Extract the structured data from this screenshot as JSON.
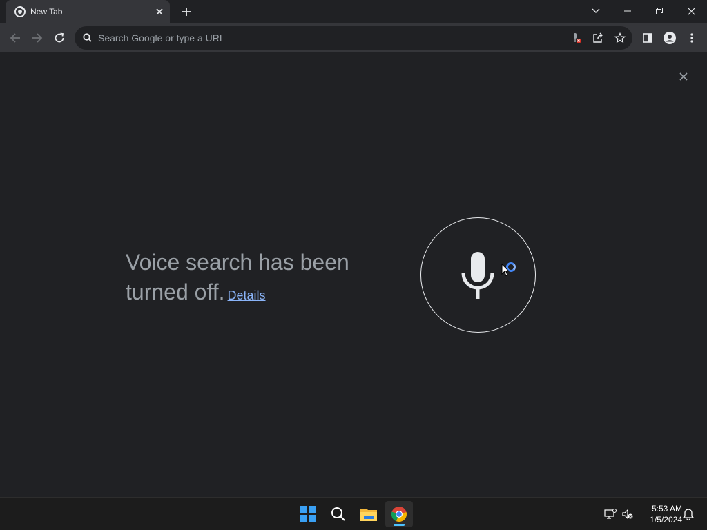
{
  "browser": {
    "tab": {
      "title": "New Tab"
    },
    "omnibox": {
      "placeholder": "Search Google or type a URL"
    }
  },
  "voice": {
    "message": "Voice search has been turned off.",
    "details_link": "Details"
  },
  "taskbar": {
    "time": "5:53 AM",
    "date": "1/5/2024"
  },
  "colors": {
    "background": "#202124",
    "toolbar": "#35363a",
    "link": "#8ab4f8",
    "text_muted": "#9aa0a6",
    "accent": "#4285f4"
  }
}
